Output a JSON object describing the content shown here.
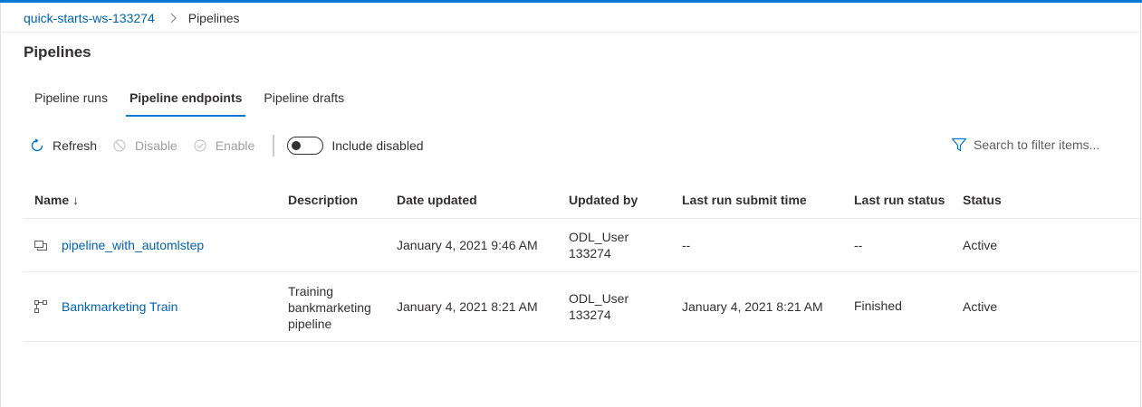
{
  "breadcrumb": {
    "workspace": "quick-starts-ws-133274",
    "current": "Pipelines"
  },
  "page": {
    "title": "Pipelines"
  },
  "tabs": [
    {
      "label": "Pipeline runs",
      "active": false
    },
    {
      "label": "Pipeline endpoints",
      "active": true
    },
    {
      "label": "Pipeline drafts",
      "active": false
    }
  ],
  "toolbar": {
    "refresh": "Refresh",
    "disable": "Disable",
    "enable": "Enable",
    "include_disabled": "Include disabled",
    "include_disabled_on": false
  },
  "search": {
    "placeholder": "Search to filter items..."
  },
  "table": {
    "columns": {
      "name": "Name ↓",
      "description": "Description",
      "date_updated": "Date updated",
      "updated_by": "Updated by",
      "last_run_submit_time": "Last run submit time",
      "last_run_status": "Last run status",
      "status": "Status"
    },
    "rows": [
      {
        "icon": "pipeline-endpoint-icon",
        "name": "pipeline_with_automlstep",
        "description": "",
        "date_updated": "January 4, 2021 9:46 AM",
        "updated_by_1": "ODL_User",
        "updated_by_2": "133274",
        "last_run_submit_time": "--",
        "last_run_status": "--",
        "status": "Active"
      },
      {
        "icon": "pipeline-graph-icon",
        "name": "Bankmarketing Train",
        "description_1": "Training",
        "description_2": "bankmarketing",
        "description_3": "pipeline",
        "date_updated": "January 4, 2021 8:21 AM",
        "updated_by_1": "ODL_User",
        "updated_by_2": "133274",
        "last_run_submit_time": "January 4, 2021 8:21 AM",
        "last_run_status": "Finished",
        "status": "Active"
      }
    ]
  },
  "colors": {
    "accent": "#0078d4",
    "link": "#0062ad",
    "text": "#323130",
    "disabled": "#a19f9d"
  }
}
